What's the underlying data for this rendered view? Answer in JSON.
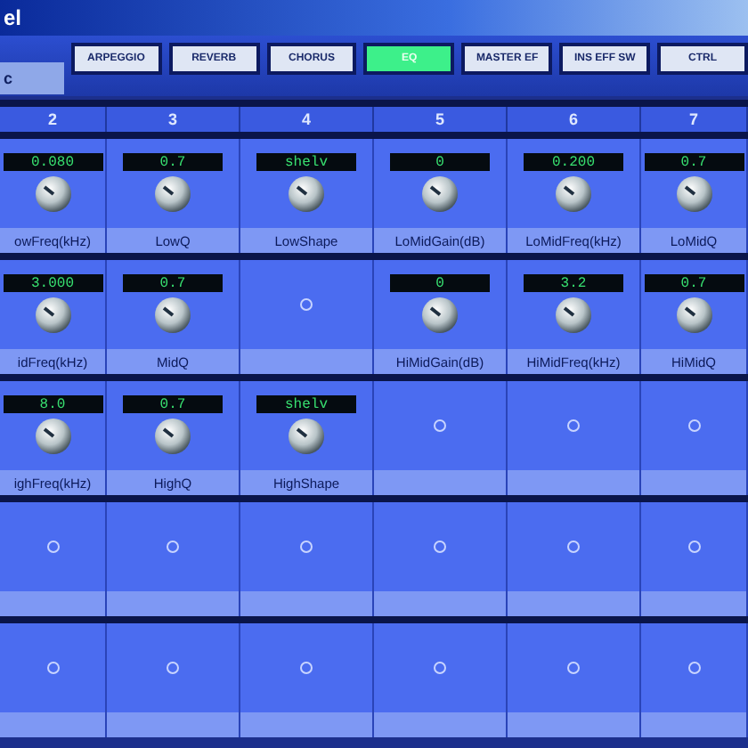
{
  "window": {
    "title": "el"
  },
  "side_label": "c",
  "tabs": [
    {
      "label": "ARPEGGIO",
      "selected": false
    },
    {
      "label": "REVERB",
      "selected": false
    },
    {
      "label": "CHORUS",
      "selected": false
    },
    {
      "label": "EQ",
      "selected": true
    },
    {
      "label": "MASTER EF",
      "selected": false
    },
    {
      "label": "INS EFF SW",
      "selected": false
    },
    {
      "label": "CTRL",
      "selected": false
    }
  ],
  "columns": [
    "2",
    "3",
    "4",
    "5",
    "6",
    "7"
  ],
  "rows": [
    [
      {
        "kind": "knob",
        "value": "0.080",
        "label": "owFreq(kHz)"
      },
      {
        "kind": "knob",
        "value": "0.7",
        "label": "LowQ"
      },
      {
        "kind": "knob",
        "value": "shelv",
        "label": "LowShape"
      },
      {
        "kind": "knob",
        "value": "0",
        "label": "LoMidGain(dB)"
      },
      {
        "kind": "knob",
        "value": "0.200",
        "label": "LoMidFreq(kHz)"
      },
      {
        "kind": "knob",
        "value": "0.7",
        "label": "LoMidQ"
      }
    ],
    [
      {
        "kind": "knob",
        "value": "3.000",
        "label": "idFreq(kHz)"
      },
      {
        "kind": "knob",
        "value": "0.7",
        "label": "MidQ"
      },
      {
        "kind": "empty"
      },
      {
        "kind": "knob",
        "value": "0",
        "label": "HiMidGain(dB)"
      },
      {
        "kind": "knob",
        "value": "3.2",
        "label": "HiMidFreq(kHz)"
      },
      {
        "kind": "knob",
        "value": "0.7",
        "label": "HiMidQ"
      }
    ],
    [
      {
        "kind": "knob",
        "value": "8.0",
        "label": "ighFreq(kHz)"
      },
      {
        "kind": "knob",
        "value": "0.7",
        "label": "HighQ"
      },
      {
        "kind": "knob",
        "value": "shelv",
        "label": "HighShape"
      },
      {
        "kind": "empty"
      },
      {
        "kind": "empty"
      },
      {
        "kind": "empty"
      }
    ],
    [
      {
        "kind": "empty"
      },
      {
        "kind": "empty"
      },
      {
        "kind": "empty"
      },
      {
        "kind": "empty"
      },
      {
        "kind": "empty"
      },
      {
        "kind": "empty"
      }
    ],
    [
      {
        "kind": "empty"
      },
      {
        "kind": "empty"
      },
      {
        "kind": "empty"
      },
      {
        "kind": "empty"
      },
      {
        "kind": "empty"
      },
      {
        "kind": "empty"
      }
    ]
  ]
}
